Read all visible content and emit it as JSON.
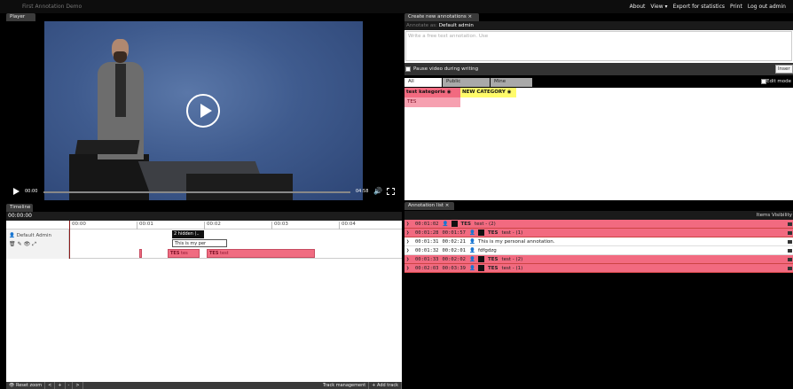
{
  "app": {
    "title": "First Annotation Demo"
  },
  "topnav": [
    "About",
    "View ▾",
    "Export for statistics",
    "Print",
    "Log out admin"
  ],
  "player": {
    "panel_title": "Player",
    "current_time": "00:00",
    "duration": "04:58",
    "progress": 0.0
  },
  "timeline": {
    "panel_title": "Timeline",
    "current_time": "00:00:00",
    "ticks": [
      "00:00",
      "00:01",
      "00:02",
      "00:03",
      "00:04"
    ],
    "track": {
      "user": "Default Admin",
      "hidden_label": "2 hidden (..",
      "tooltip": "This is my per",
      "annotations": [
        {
          "category": "TES",
          "text": "tes"
        },
        {
          "category": "TES",
          "text": "test"
        }
      ]
    },
    "footer": {
      "reset_zoom": "Reset zoom",
      "prev": "<",
      "plus": "+",
      "minus": "-",
      "next": ">",
      "track_management": "Track management",
      "add_track": "+ Add track"
    }
  },
  "create": {
    "panel_title": "Create new annotations",
    "annotate_as_label": "Annotate as:",
    "annotate_as_user": "Default admin",
    "input_placeholder": "Write a free text annotation. Use",
    "pause_label": "Pause video during writing",
    "insert_label": "Inser",
    "tabs": [
      "All",
      "Public",
      "Mine"
    ],
    "edit_mode_label": "Edit mode",
    "categories": [
      {
        "name": "test kategorie",
        "color": "#f26a80"
      },
      {
        "name": "NEW CATEGORY",
        "color": "#fffb6a"
      }
    ],
    "labels": [
      "TES"
    ]
  },
  "annotation_list": {
    "panel_title": "Annotation list",
    "visibility_label": "Items Visibility",
    "rows": [
      {
        "start": "00:01:02",
        "end": "",
        "category": "TES",
        "text": "test - (2)",
        "style": "pink",
        "locked": true
      },
      {
        "start": "00:01:28",
        "end": "00:01:57",
        "category": "TES",
        "text": "test - (1)",
        "style": "pink",
        "locked": true
      },
      {
        "start": "00:01:31",
        "end": "00:02:21",
        "category": "",
        "text": "This is my personal annotation.",
        "style": "white",
        "locked": false
      },
      {
        "start": "00:01:32",
        "end": "00:02:01",
        "category": "",
        "text": "fdfgdzg",
        "style": "white",
        "locked": false
      },
      {
        "start": "00:01:33",
        "end": "00:02:02",
        "category": "TES",
        "text": "test - (2)",
        "style": "pink",
        "locked": true
      },
      {
        "start": "00:02:03",
        "end": "00:03:39",
        "category": "TES",
        "text": "test - (1)",
        "style": "pink",
        "locked": true
      }
    ]
  }
}
